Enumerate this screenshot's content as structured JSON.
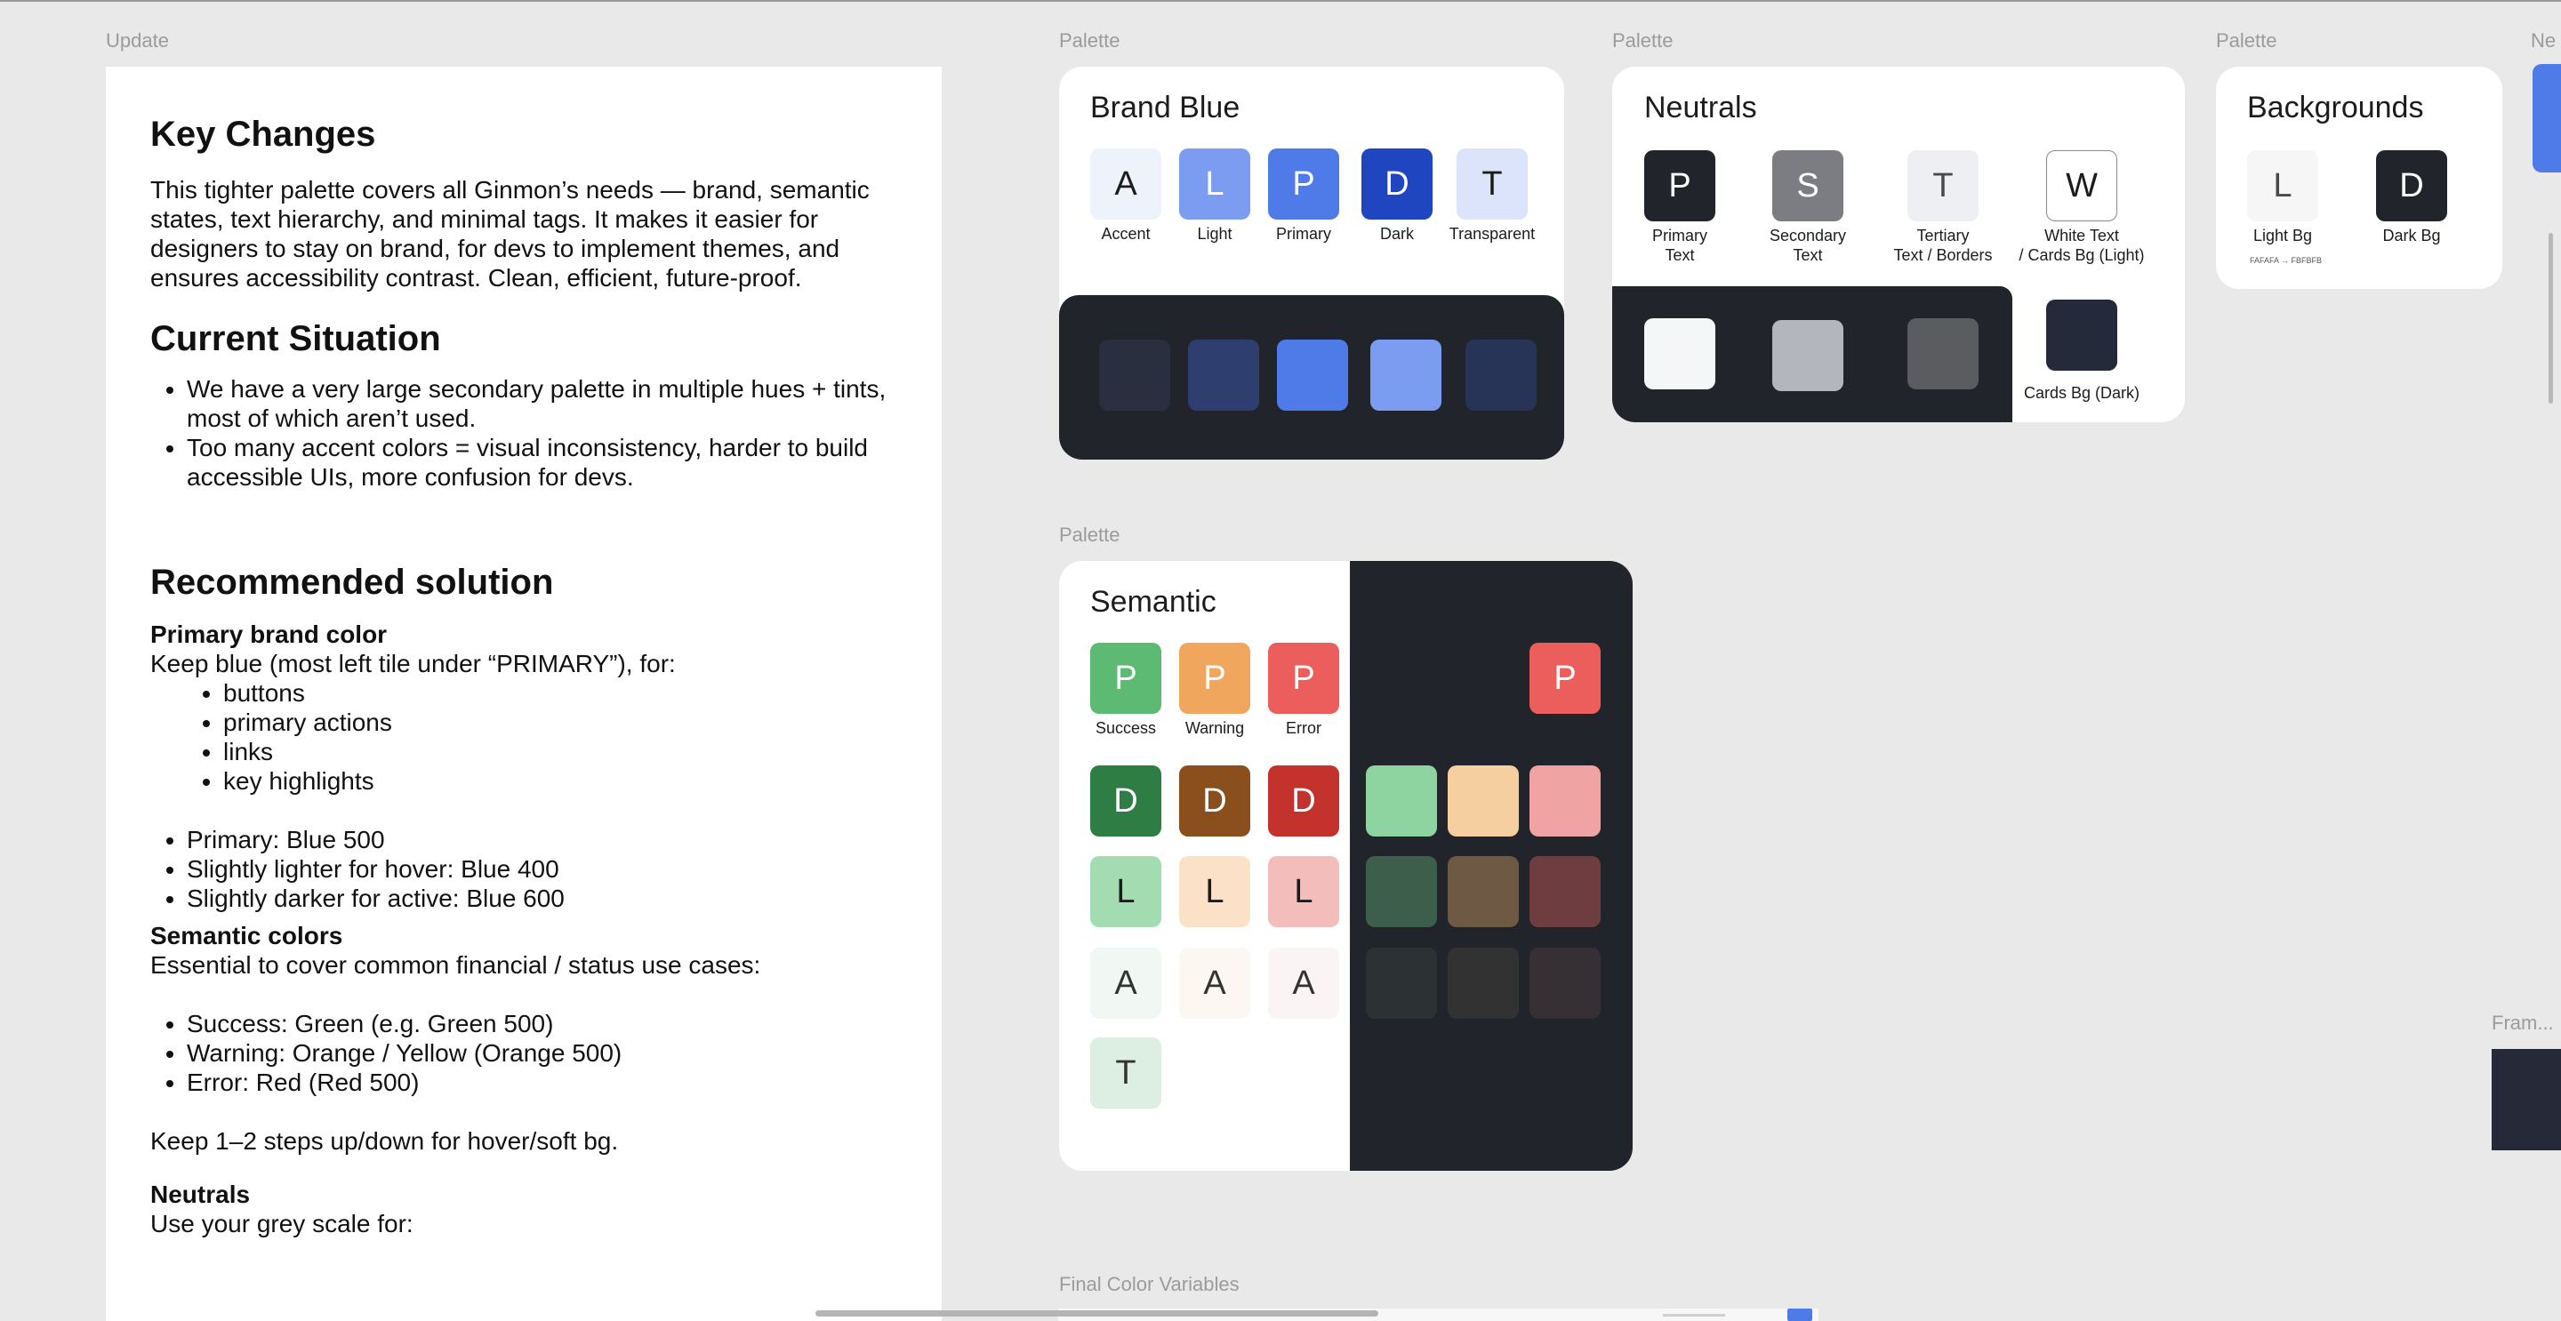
{
  "frames": {
    "update": "Update",
    "palette": "Palette",
    "next": "Ne",
    "frame": "Fram...",
    "final": "Final Color Variables"
  },
  "doc": {
    "h_key": "Key Changes",
    "key_para": "This tighter palette covers all Ginmon’s needs — brand, semantic states, text hierarchy, and minimal tags. It makes it easier for designers to stay on brand, for devs to implement themes, and ensures accessibility contrast. Clean, efficient, future-proof.",
    "h_current": "Current Situation",
    "current": [
      "We have a very large secondary palette in multiple hues + tints, most of which aren’t used.",
      "Too many accent colors = visual inconsistency, harder to build accessible UIs, more confusion for devs."
    ],
    "h_rec": "Recommended solution",
    "primary_title": "Primary brand color",
    "primary_intro": "Keep blue (most left tile under “PRIMARY”), for:",
    "primary_uses": [
      "buttons",
      "primary actions",
      "links",
      "key highlights"
    ],
    "primary_steps": [
      "Primary: Blue 500",
      "Slightly lighter for hover: Blue 400",
      "Slightly darker for active: Blue 600"
    ],
    "semantic_title": "Semantic colors",
    "semantic_intro": "Essential to cover common financial / status use cases:",
    "semantic_items": [
      "Success: Green (e.g. Green 500)",
      "Warning: Orange / Yellow (Orange 500)",
      "Error: Red (Red 500)"
    ],
    "steps_note": "Keep 1–2 steps up/down for hover/soft bg.",
    "neutrals_title": "Neutrals",
    "neutrals_intro": "Use your grey scale for:"
  },
  "brand_blue": {
    "title": "Brand Blue",
    "tiles": [
      {
        "letter": "A",
        "label": "Accent",
        "color": "#eef2fb"
      },
      {
        "letter": "L",
        "label": "Light",
        "color": "#7b9cf0"
      },
      {
        "letter": "P",
        "label": "Primary",
        "color": "#4f7be8"
      },
      {
        "letter": "D",
        "label": "Dark",
        "color": "#1f45c0"
      },
      {
        "letter": "T",
        "label": "Transparent",
        "color": "#dbe4fa"
      }
    ],
    "dark_swatches": [
      "#2a2f3f",
      "#2e3e6e",
      "#4f7be8",
      "#7b9cf0",
      "#283457"
    ]
  },
  "neutrals": {
    "title": "Neutrals",
    "tiles": [
      {
        "letter": "P",
        "line1": "Primary",
        "line2": "Text",
        "color": "#22242b"
      },
      {
        "letter": "S",
        "line1": "Secondary",
        "line2": "Text",
        "color": "#7b7d82"
      },
      {
        "letter": "T",
        "line1": "Tertiary",
        "line2": "Text / Borders",
        "color": "#eeeff2"
      },
      {
        "letter": "W",
        "line1": "White Text",
        "line2": "/ Cards Bg (Light)",
        "color": "#ffffff"
      }
    ],
    "dark_swatches": [
      "#f5f6f8",
      "#b3b6bd",
      "#5a5c60"
    ],
    "cards_bg_dark": {
      "label": "Cards Bg (Dark)",
      "color": "#252a3a"
    }
  },
  "backgrounds": {
    "title": "Backgrounds",
    "tiles": [
      {
        "letter": "L",
        "label": "Light Bg",
        "note": "FAFAFA → FBFBFB",
        "color": "#f6f6f6"
      },
      {
        "letter": "D",
        "label": "Dark Bg",
        "note": "",
        "color": "#22242b"
      }
    ]
  },
  "semantic": {
    "title": "Semantic",
    "primary_row": [
      {
        "letter": "P",
        "label": "Success",
        "color": "#5dba72"
      },
      {
        "letter": "P",
        "label": "Warning",
        "color": "#f0a65c"
      },
      {
        "letter": "P",
        "label": "Error",
        "color": "#eb5e5b"
      }
    ],
    "dark_row": [
      {
        "letter": "D",
        "color": "#2e7d44"
      },
      {
        "letter": "D",
        "color": "#8a4f1c"
      },
      {
        "letter": "D",
        "color": "#c4322e"
      }
    ],
    "light_row": [
      {
        "letter": "L",
        "color": "#a2dcb0"
      },
      {
        "letter": "L",
        "color": "#fbe1c7"
      },
      {
        "letter": "L",
        "color": "#f3bdbc"
      }
    ],
    "accent_row": [
      {
        "letter": "A",
        "color": "#f1f8f3"
      },
      {
        "letter": "A",
        "color": "#fdf7f1"
      },
      {
        "letter": "A",
        "color": "#fbf4f4"
      }
    ],
    "transparent": {
      "letter": "T",
      "color": "#dcefe2"
    },
    "dark_primary": {
      "letter": "P",
      "color": "#eb5e5b"
    },
    "dark_grid": [
      [
        "#8dd4a0",
        "#f5cf9f",
        "#f0a3a3"
      ],
      [
        "#3c5e4a",
        "#6e5945",
        "#6e3d40"
      ],
      [
        "#2c3233",
        "#333233",
        "#363034"
      ]
    ]
  }
}
